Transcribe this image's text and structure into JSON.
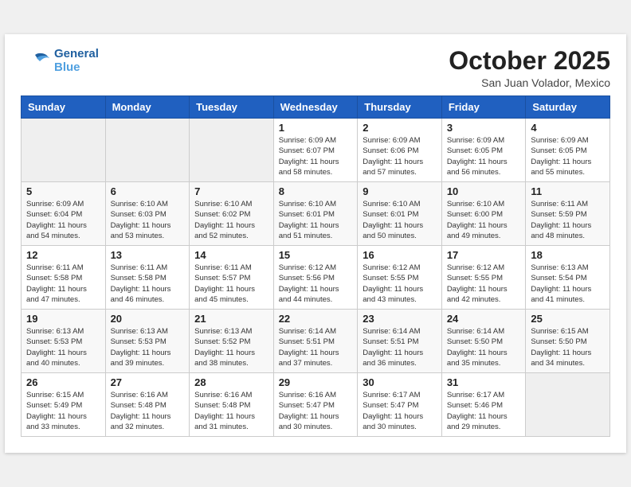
{
  "header": {
    "logo_line1": "General",
    "logo_line2": "Blue",
    "month": "October 2025",
    "location": "San Juan Volador, Mexico"
  },
  "weekdays": [
    "Sunday",
    "Monday",
    "Tuesday",
    "Wednesday",
    "Thursday",
    "Friday",
    "Saturday"
  ],
  "weeks": [
    [
      {
        "day": "",
        "info": ""
      },
      {
        "day": "",
        "info": ""
      },
      {
        "day": "",
        "info": ""
      },
      {
        "day": "1",
        "info": "Sunrise: 6:09 AM\nSunset: 6:07 PM\nDaylight: 11 hours\nand 58 minutes."
      },
      {
        "day": "2",
        "info": "Sunrise: 6:09 AM\nSunset: 6:06 PM\nDaylight: 11 hours\nand 57 minutes."
      },
      {
        "day": "3",
        "info": "Sunrise: 6:09 AM\nSunset: 6:05 PM\nDaylight: 11 hours\nand 56 minutes."
      },
      {
        "day": "4",
        "info": "Sunrise: 6:09 AM\nSunset: 6:05 PM\nDaylight: 11 hours\nand 55 minutes."
      }
    ],
    [
      {
        "day": "5",
        "info": "Sunrise: 6:09 AM\nSunset: 6:04 PM\nDaylight: 11 hours\nand 54 minutes."
      },
      {
        "day": "6",
        "info": "Sunrise: 6:10 AM\nSunset: 6:03 PM\nDaylight: 11 hours\nand 53 minutes."
      },
      {
        "day": "7",
        "info": "Sunrise: 6:10 AM\nSunset: 6:02 PM\nDaylight: 11 hours\nand 52 minutes."
      },
      {
        "day": "8",
        "info": "Sunrise: 6:10 AM\nSunset: 6:01 PM\nDaylight: 11 hours\nand 51 minutes."
      },
      {
        "day": "9",
        "info": "Sunrise: 6:10 AM\nSunset: 6:01 PM\nDaylight: 11 hours\nand 50 minutes."
      },
      {
        "day": "10",
        "info": "Sunrise: 6:10 AM\nSunset: 6:00 PM\nDaylight: 11 hours\nand 49 minutes."
      },
      {
        "day": "11",
        "info": "Sunrise: 6:11 AM\nSunset: 5:59 PM\nDaylight: 11 hours\nand 48 minutes."
      }
    ],
    [
      {
        "day": "12",
        "info": "Sunrise: 6:11 AM\nSunset: 5:58 PM\nDaylight: 11 hours\nand 47 minutes."
      },
      {
        "day": "13",
        "info": "Sunrise: 6:11 AM\nSunset: 5:58 PM\nDaylight: 11 hours\nand 46 minutes."
      },
      {
        "day": "14",
        "info": "Sunrise: 6:11 AM\nSunset: 5:57 PM\nDaylight: 11 hours\nand 45 minutes."
      },
      {
        "day": "15",
        "info": "Sunrise: 6:12 AM\nSunset: 5:56 PM\nDaylight: 11 hours\nand 44 minutes."
      },
      {
        "day": "16",
        "info": "Sunrise: 6:12 AM\nSunset: 5:55 PM\nDaylight: 11 hours\nand 43 minutes."
      },
      {
        "day": "17",
        "info": "Sunrise: 6:12 AM\nSunset: 5:55 PM\nDaylight: 11 hours\nand 42 minutes."
      },
      {
        "day": "18",
        "info": "Sunrise: 6:13 AM\nSunset: 5:54 PM\nDaylight: 11 hours\nand 41 minutes."
      }
    ],
    [
      {
        "day": "19",
        "info": "Sunrise: 6:13 AM\nSunset: 5:53 PM\nDaylight: 11 hours\nand 40 minutes."
      },
      {
        "day": "20",
        "info": "Sunrise: 6:13 AM\nSunset: 5:53 PM\nDaylight: 11 hours\nand 39 minutes."
      },
      {
        "day": "21",
        "info": "Sunrise: 6:13 AM\nSunset: 5:52 PM\nDaylight: 11 hours\nand 38 minutes."
      },
      {
        "day": "22",
        "info": "Sunrise: 6:14 AM\nSunset: 5:51 PM\nDaylight: 11 hours\nand 37 minutes."
      },
      {
        "day": "23",
        "info": "Sunrise: 6:14 AM\nSunset: 5:51 PM\nDaylight: 11 hours\nand 36 minutes."
      },
      {
        "day": "24",
        "info": "Sunrise: 6:14 AM\nSunset: 5:50 PM\nDaylight: 11 hours\nand 35 minutes."
      },
      {
        "day": "25",
        "info": "Sunrise: 6:15 AM\nSunset: 5:50 PM\nDaylight: 11 hours\nand 34 minutes."
      }
    ],
    [
      {
        "day": "26",
        "info": "Sunrise: 6:15 AM\nSunset: 5:49 PM\nDaylight: 11 hours\nand 33 minutes."
      },
      {
        "day": "27",
        "info": "Sunrise: 6:16 AM\nSunset: 5:48 PM\nDaylight: 11 hours\nand 32 minutes."
      },
      {
        "day": "28",
        "info": "Sunrise: 6:16 AM\nSunset: 5:48 PM\nDaylight: 11 hours\nand 31 minutes."
      },
      {
        "day": "29",
        "info": "Sunrise: 6:16 AM\nSunset: 5:47 PM\nDaylight: 11 hours\nand 30 minutes."
      },
      {
        "day": "30",
        "info": "Sunrise: 6:17 AM\nSunset: 5:47 PM\nDaylight: 11 hours\nand 30 minutes."
      },
      {
        "day": "31",
        "info": "Sunrise: 6:17 AM\nSunset: 5:46 PM\nDaylight: 11 hours\nand 29 minutes."
      },
      {
        "day": "",
        "info": ""
      }
    ]
  ]
}
